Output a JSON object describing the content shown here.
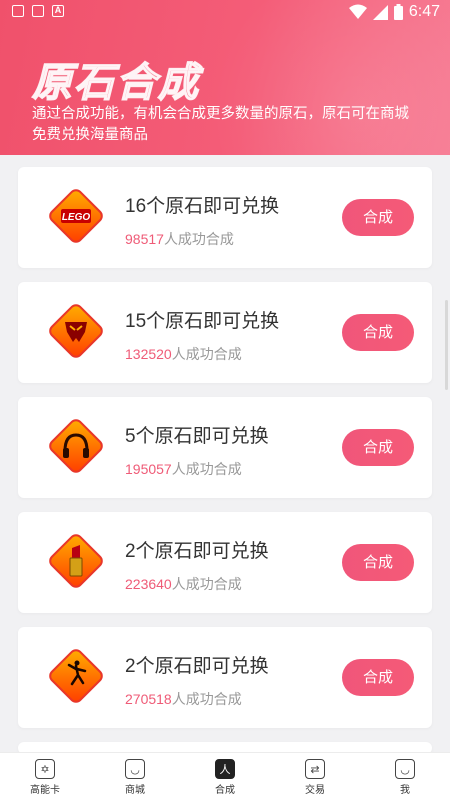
{
  "status": {
    "time": "6:47"
  },
  "header": {
    "title": "原石合成",
    "description": "通过合成功能，有机会合成更多数量的原石，原石可在商城免费兑换海量商品"
  },
  "colors": {
    "accent": "#ef5b77",
    "header_bg": "#f0516b"
  },
  "items": [
    {
      "title": "16个原石即可兑换",
      "count": "98517",
      "suffix": "人成功合成",
      "button": "合成",
      "icon": "lego-icon",
      "icon_text": "LEGO"
    },
    {
      "title": "15个原石即可兑换",
      "count": "132520",
      "suffix": "人成功合成",
      "button": "合成",
      "icon": "transformers-icon"
    },
    {
      "title": "5个原石即可兑换",
      "count": "195057",
      "suffix": "人成功合成",
      "button": "合成",
      "icon": "headphones-icon"
    },
    {
      "title": "2个原石即可兑换",
      "count": "223640",
      "suffix": "人成功合成",
      "button": "合成",
      "icon": "lipstick-icon"
    },
    {
      "title": "2个原石即可兑换",
      "count": "270518",
      "suffix": "人成功合成",
      "button": "合成",
      "icon": "jumpman-icon"
    }
  ],
  "tabs": [
    {
      "label": "高能卡",
      "icon": "star-of-david-icon",
      "active": false
    },
    {
      "label": "商城",
      "icon": "bag-icon",
      "active": false
    },
    {
      "label": "合成",
      "icon": "synthesis-icon",
      "active": true
    },
    {
      "label": "交易",
      "icon": "exchange-icon",
      "active": false
    },
    {
      "label": "我",
      "icon": "face-icon",
      "active": false
    }
  ]
}
